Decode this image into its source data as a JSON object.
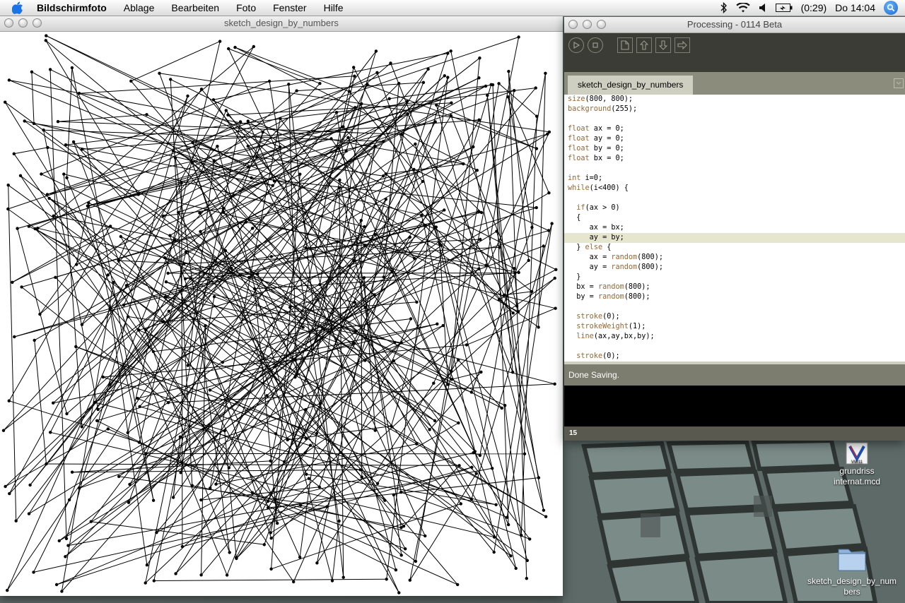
{
  "menubar": {
    "app_name": "Bildschirmfoto",
    "items": [
      "Ablage",
      "Bearbeiten",
      "Foto",
      "Fenster",
      "Hilfe"
    ],
    "battery": "(0:29)",
    "clock": "Do 14:04"
  },
  "sketch_window": {
    "title": "sketch_design_by_numbers"
  },
  "pde_window": {
    "title": "Processing - 0114 Beta",
    "tab": "sketch_design_by_numbers",
    "code": [
      "size(800, 800);",
      "background(255);",
      "",
      "float ax = 0;",
      "float ay = 0;",
      "float by = 0;",
      "float bx = 0;",
      "",
      "int i=0;",
      "while(i<400) {",
      "",
      "  if(ax > 0)",
      "  {",
      "     ax = bx;",
      "     ay = by;",
      "  } else {",
      "     ax = random(800);",
      "     ay = random(800);",
      "  }",
      "  bx = random(800);",
      "  by = random(800);",
      "",
      "  stroke(0);",
      "  strokeWeight(1);",
      "  line(ax,ay,bx,by);",
      "",
      "  stroke(0);"
    ],
    "highlight_line": 14,
    "status_message": "Done Saving.",
    "line_number": "15"
  },
  "desktop": {
    "icons": [
      {
        "label": "grundriss internat.mcd",
        "icon": "vectorworks-file-icon",
        "badge": "VW11"
      },
      {
        "label": "sketch_design_by_numbers",
        "icon": "folder-icon"
      }
    ]
  },
  "colors": {
    "toolbar": "#3c3c36",
    "tabbar": "#8c8c7c",
    "status": "#7d7d6f",
    "keyword": "#996633",
    "highlight": "#e6e6cf"
  }
}
